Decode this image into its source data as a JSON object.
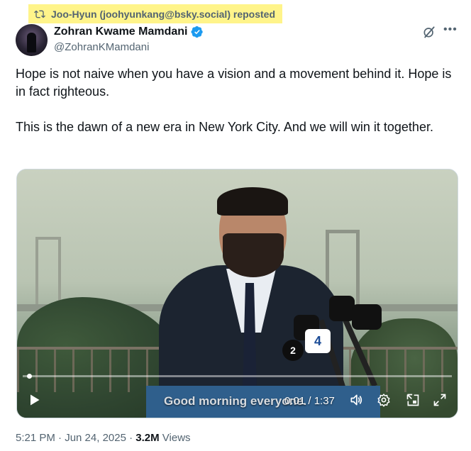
{
  "repost": {
    "label": "Joo-Hyun (joohyunkang@bsky.social) reposted",
    "highlight": "#fff48a"
  },
  "author": {
    "name": "Zohran Kwame Mamdani",
    "handle": "@ZohranKMamdani",
    "verified_color": "#1d9bf0"
  },
  "post": {
    "paragraphs": [
      "Hope is not naive when you have a vision and a movement behind it. Hope is in fact righteous.",
      "This is the dawn of a new era in New York City. And we will win it together."
    ]
  },
  "video": {
    "caption": "Good morning everyone.",
    "time": "0:01 / 1:37",
    "progress": 0.01,
    "mic_labels": {
      "nbc": "4",
      "channel": "2"
    }
  },
  "meta": {
    "timestamp": "5:21 PM · Jun 24, 2025 · ",
    "views_count": "3.2M",
    "views_label": " Views"
  },
  "icons": [
    "repost-icon",
    "verified-icon",
    "grok-icon",
    "more-icon",
    "play-icon",
    "volume-icon",
    "settings-icon",
    "pip-icon",
    "fullscreen-icon"
  ]
}
